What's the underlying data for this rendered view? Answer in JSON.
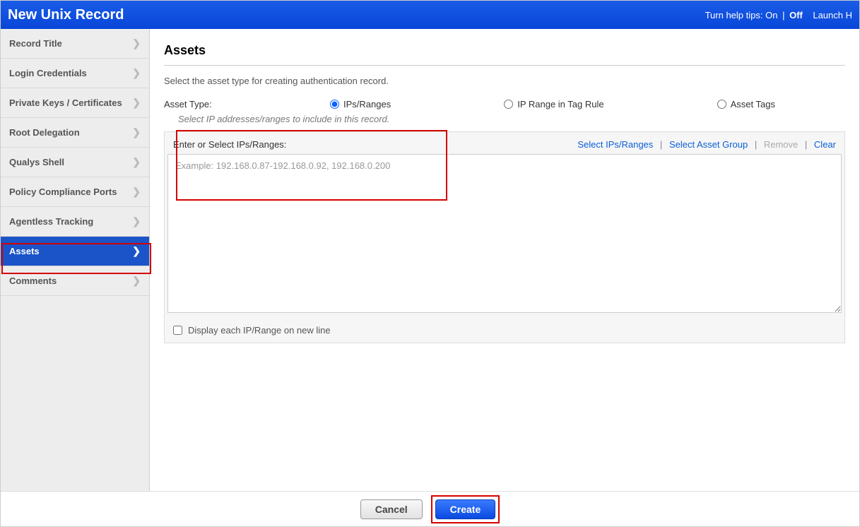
{
  "header": {
    "title": "New Unix Record",
    "help_prefix": "Turn help tips:",
    "help_on": "On",
    "help_off": "Off",
    "launch": "Launch H"
  },
  "sidebar": {
    "items": [
      {
        "label": "Record Title"
      },
      {
        "label": "Login Credentials"
      },
      {
        "label": "Private Keys / Certificates"
      },
      {
        "label": "Root Delegation"
      },
      {
        "label": "Qualys Shell"
      },
      {
        "label": "Policy Compliance Ports"
      },
      {
        "label": "Agentless Tracking"
      },
      {
        "label": "Assets"
      },
      {
        "label": "Comments"
      }
    ]
  },
  "main": {
    "heading": "Assets",
    "intro": "Select the asset type for creating authentication record.",
    "asset_type_label": "Asset Type:",
    "radios": {
      "ips": "IPs/Ranges",
      "tag_rule": "IP Range in Tag Rule",
      "asset_tags": "Asset Tags"
    },
    "hint": "Select IP addresses/ranges to include in this record.",
    "enter_label": "Enter or Select IPs/Ranges:",
    "links": {
      "select_ips": "Select IPs/Ranges",
      "select_group": "Select Asset Group",
      "remove": "Remove",
      "clear": "Clear"
    },
    "placeholder": "Example: 192.168.0.87-192.168.0.92, 192.168.0.200",
    "display_each": "Display each IP/Range on new line"
  },
  "footer": {
    "cancel": "Cancel",
    "create": "Create"
  }
}
